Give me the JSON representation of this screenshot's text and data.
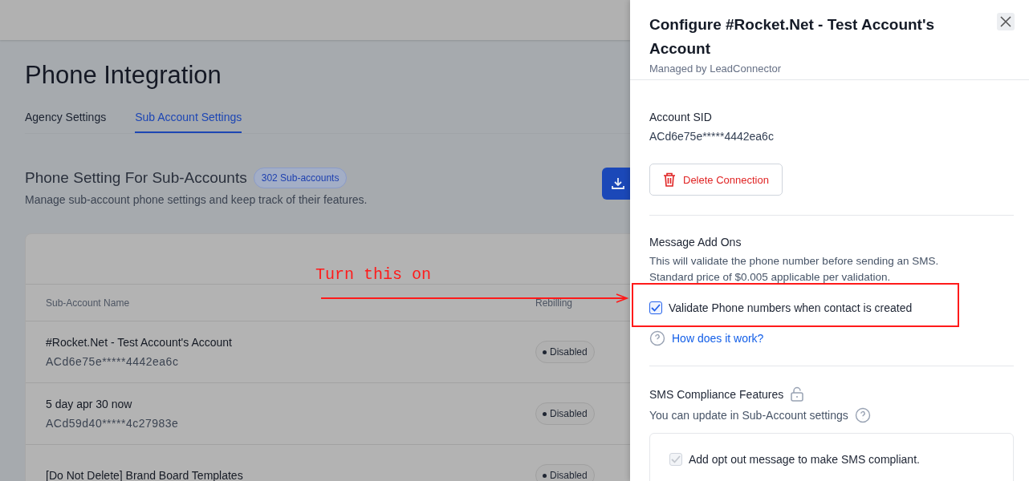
{
  "page": {
    "title": "Phone Integration",
    "tabs": [
      {
        "label": "Agency Settings",
        "selected": false
      },
      {
        "label": "Sub Account Settings",
        "selected": true
      }
    ],
    "section": {
      "title": "Phone Setting For Sub-Accounts",
      "badge": "302 Sub-accounts",
      "subtitle": "Manage sub-account phone settings and keep track of their features."
    },
    "table": {
      "columns": [
        "Sub-Account Name",
        "Rebilling"
      ],
      "rows": [
        {
          "name": "#Rocket.Net - Test Account's Account",
          "sid": "ACd6e75e*****4442ea6c",
          "rebilling": "Disabled"
        },
        {
          "name": "5 day apr 30 now",
          "sid": "ACd59d40*****4c27983e",
          "rebilling": "Disabled"
        },
        {
          "name": "[Do Not Delete] Brand Board Templates",
          "rebilling": "Disabled"
        }
      ]
    }
  },
  "drawer": {
    "title": "Configure #Rocket.Net - Test Account's Account",
    "subtitle": "Managed by LeadConnector",
    "sid_label": "Account SID",
    "sid_value": "ACd6e75e*****4442ea6c",
    "delete_button": "Delete Connection",
    "addons": {
      "title": "Message Add Ons",
      "description": "This will validate the phone number before sending an SMS. Standard price of $0.005 applicable per validation.",
      "option": {
        "label": "Validate Phone numbers when contact is created",
        "checked": true
      },
      "help_link": "How does it work?"
    },
    "compliance": {
      "title": "SMS Compliance Features",
      "subtitle": "You can update in Sub-Account settings",
      "option": {
        "label": "Add opt out message to make SMS compliant.",
        "checked": true,
        "disabled": true
      }
    }
  },
  "annotation": {
    "text": "Turn this on"
  }
}
